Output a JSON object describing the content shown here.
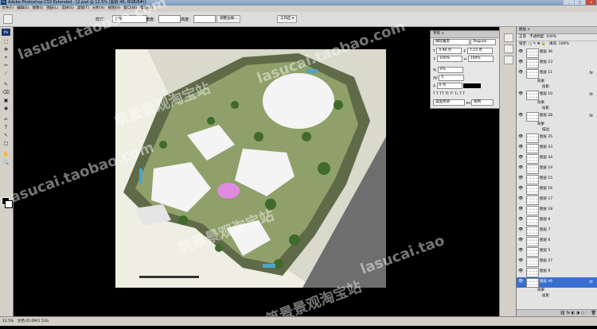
{
  "window": {
    "title": "Adobe Photoshop CS3 Extended - [2.psd @ 12.5% (图层 46, RGB/8#)]",
    "controls": [
      "_",
      "□",
      "×"
    ]
  },
  "menu": [
    "文件(F)",
    "编辑(E)",
    "图像(I)",
    "图层(L)",
    "选择(S)",
    "滤镜(T)",
    "分析(A)",
    "视图(V)",
    "窗口(W)",
    "帮助(H)"
  ],
  "options": {
    "style_label": "样式:",
    "style_value": "正常",
    "width_label": "宽度:",
    "height_label": "高度:",
    "refine_button": "调整边缘...",
    "workspace_button": "工作区 ▾"
  },
  "tools": [
    "⬚",
    "✥",
    "⌖",
    "✂",
    "⟋",
    "✎",
    "⌫",
    "▣",
    "◉",
    "✍",
    "T",
    "↖",
    "□",
    "✋",
    "🔍"
  ],
  "watermarks": [
    "lasucai.taobao.com",
    "筑景景观淘宝站",
    "asucai.taobao.com",
    "筑景景观淘宝站",
    "lasucai.taobao.com",
    "筑景景观淘宝站",
    "lasucai.tao",
    "筑景景"
  ],
  "character_panel": {
    "title": "字符 ×",
    "font": "微软雅黑",
    "style": "Regular",
    "size": "4.98 点",
    "leading": "7.23 点",
    "scale_v": "100%",
    "scale_h": "100%",
    "tracking": "0%",
    "kerning": "0",
    "baseline": "0 点",
    "lang": "美国英语",
    "aa": "锐利"
  },
  "layers_panel": {
    "title": "图层 ×",
    "blend": "正常",
    "opacity_label": "不透明度:",
    "opacity": "100%",
    "lock_label": "锁定:",
    "fill_label": "填充:",
    "fill": "100%",
    "rows": [
      {
        "name": "图层 36",
        "fx": false,
        "sel": false,
        "sub": []
      },
      {
        "name": "图层 23",
        "fx": false,
        "sel": false,
        "sub": []
      },
      {
        "name": "图层 11",
        "fx": true,
        "sel": false,
        "sub": [
          "效果",
          "投影"
        ]
      },
      {
        "name": "图层 10",
        "fx": true,
        "sel": false,
        "sub": [
          "效果",
          "投影"
        ]
      },
      {
        "name": "图层 28",
        "fx": true,
        "sel": false,
        "sub": [
          "效果",
          "描边"
        ]
      },
      {
        "name": "图层 35",
        "fx": false,
        "sel": false,
        "sub": []
      },
      {
        "name": "图层 33",
        "fx": false,
        "sel": false,
        "sub": []
      },
      {
        "name": "图层 34",
        "fx": false,
        "sel": false,
        "sub": []
      },
      {
        "name": "图层 14",
        "fx": false,
        "sel": false,
        "sub": []
      },
      {
        "name": "图层 15",
        "fx": false,
        "sel": false,
        "sub": []
      },
      {
        "name": "图层 16",
        "fx": false,
        "sel": false,
        "sub": []
      },
      {
        "name": "图层 17",
        "fx": false,
        "sel": false,
        "sub": []
      },
      {
        "name": "图层 18",
        "fx": false,
        "sel": false,
        "sub": []
      },
      {
        "name": "图层 8",
        "fx": false,
        "sel": false,
        "sub": []
      },
      {
        "name": "图层 7",
        "fx": false,
        "sel": false,
        "sub": []
      },
      {
        "name": "图层 6",
        "fx": false,
        "sel": false,
        "sub": []
      },
      {
        "name": "图层 5",
        "fx": false,
        "sel": false,
        "sub": []
      },
      {
        "name": "图层 27",
        "fx": false,
        "sel": false,
        "sub": []
      },
      {
        "name": "图层 9",
        "fx": false,
        "sel": false,
        "sub": []
      },
      {
        "name": "图层 46",
        "fx": true,
        "sel": true,
        "sub": [
          "效果",
          "投影"
        ]
      }
    ],
    "footer": "⛓ fx ◐ ◑ ▭ 🗀 🗑"
  },
  "status": {
    "zoom": "12.5%",
    "doc": "文档:45.0M/1.53G"
  }
}
